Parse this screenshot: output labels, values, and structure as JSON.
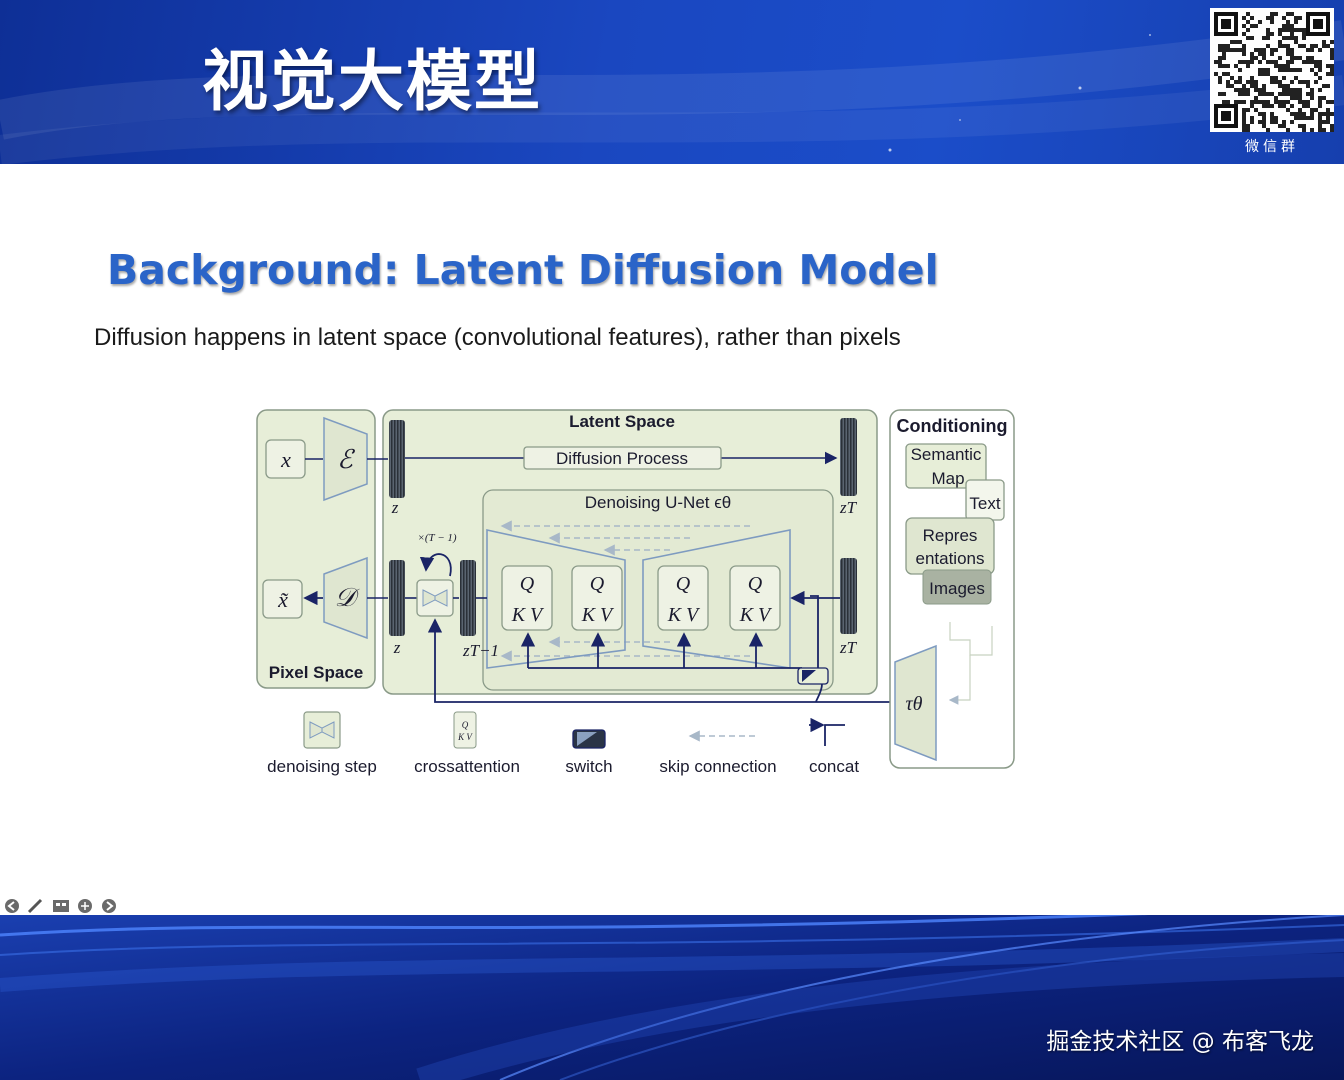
{
  "header": {
    "title": "视觉大模型",
    "qr_caption": "微信群"
  },
  "slide": {
    "title": "Background: Latent Diffusion Model",
    "subtitle": "Diffusion happens in latent space (convolutional features), rather than pixels"
  },
  "diagram": {
    "pixel_space_label": "Pixel Space",
    "latent_space_label": "Latent Space",
    "conditioning_label": "Conditioning",
    "diffusion_process_label": "Diffusion Process",
    "unet_label": "Denoising U-Net ϵθ",
    "x_symbol": "x",
    "x_tilde_symbol": "x̃",
    "encoder_symbol": "ℰ",
    "decoder_symbol": "𝒟",
    "z_label": "z",
    "zT_label": "zT",
    "zT1_label": "zT−1",
    "repeat_label": "×(T − 1)",
    "tau_label": "τθ",
    "q_label": "Q",
    "kv_label": "K V",
    "cond_semantic_1": "Semantic",
    "cond_semantic_2": "Map",
    "cond_text": "Text",
    "cond_repr_1": "Repres",
    "cond_repr_2": "entations",
    "cond_images": "Images"
  },
  "legend": {
    "denoising_step": "denoising step",
    "crossattention": "crossattention",
    "switch": "switch",
    "skip_connection": "skip connection",
    "concat": "concat"
  },
  "watermark": "掘金技术社区 @ 布客飞龙",
  "colors": {
    "header_blue": "#1a47c0",
    "title_blue": "#2a64c8",
    "diagram_fill": "#e7eed8",
    "arrow_navy": "#1a2466",
    "unet_blue": "#7e9bc0"
  },
  "toolbar_icons": [
    "back-icon",
    "pen-icon",
    "slides-icon",
    "zoom-icon",
    "forward-icon"
  ]
}
